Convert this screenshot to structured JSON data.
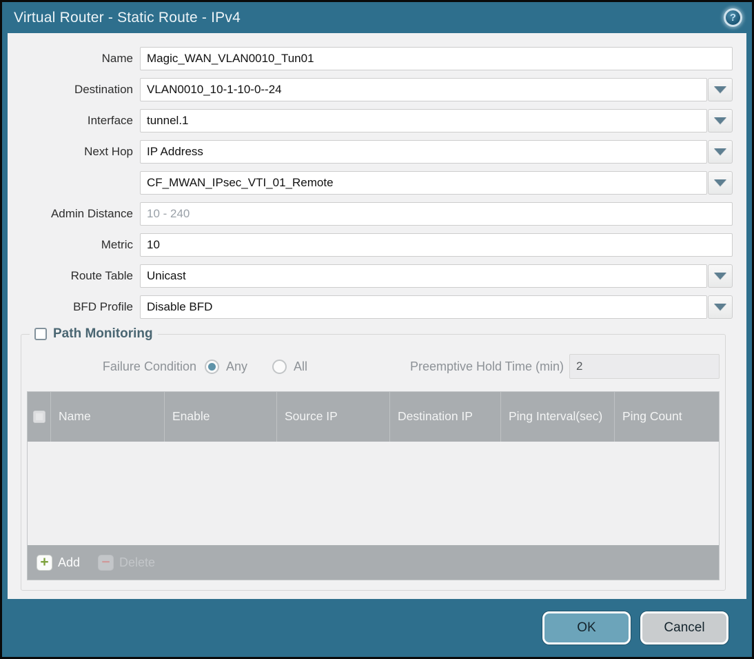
{
  "title": "Virtual Router - Static Route - IPv4",
  "help_icon": "?",
  "fields": {
    "name": {
      "label": "Name",
      "value": "Magic_WAN_VLAN0010_Tun01"
    },
    "destination": {
      "label": "Destination",
      "value": "VLAN0010_10-1-10-0--24"
    },
    "interface": {
      "label": "Interface",
      "value": "tunnel.1"
    },
    "next_hop": {
      "label": "Next Hop",
      "value": "IP Address"
    },
    "next_hop_address": {
      "value": "CF_MWAN_IPsec_VTI_01_Remote"
    },
    "admin_distance": {
      "label": "Admin Distance",
      "placeholder": "10 - 240",
      "value": ""
    },
    "metric": {
      "label": "Metric",
      "value": "10"
    },
    "route_table": {
      "label": "Route Table",
      "value": "Unicast"
    },
    "bfd_profile": {
      "label": "BFD Profile",
      "value": "Disable BFD"
    }
  },
  "path_monitoring": {
    "title": "Path Monitoring",
    "checked": false,
    "failure_condition": {
      "label": "Failure Condition",
      "options": [
        {
          "label": "Any",
          "selected": true
        },
        {
          "label": "All",
          "selected": false
        }
      ]
    },
    "preemptive_hold_time": {
      "label": "Preemptive Hold Time (min)",
      "value": "2"
    },
    "table": {
      "columns": [
        "Name",
        "Enable",
        "Source IP",
        "Destination IP",
        "Ping Interval(sec)",
        "Ping Count"
      ],
      "rows": []
    },
    "add_label": "Add",
    "delete_label": "Delete",
    "add_icon": "+",
    "delete_icon": "−"
  },
  "footer": {
    "ok_label": "OK",
    "cancel_label": "Cancel"
  },
  "colors": {
    "frame_teal": "#2e6f8d",
    "content_bg": "#f1f1f2",
    "table_header_gray": "#a9adb0",
    "ok_button": "#6ca4ba",
    "cancel_button": "#c9ccce",
    "radio_selected": "#5f93a9",
    "add_plus_green": "#7ca23c"
  }
}
